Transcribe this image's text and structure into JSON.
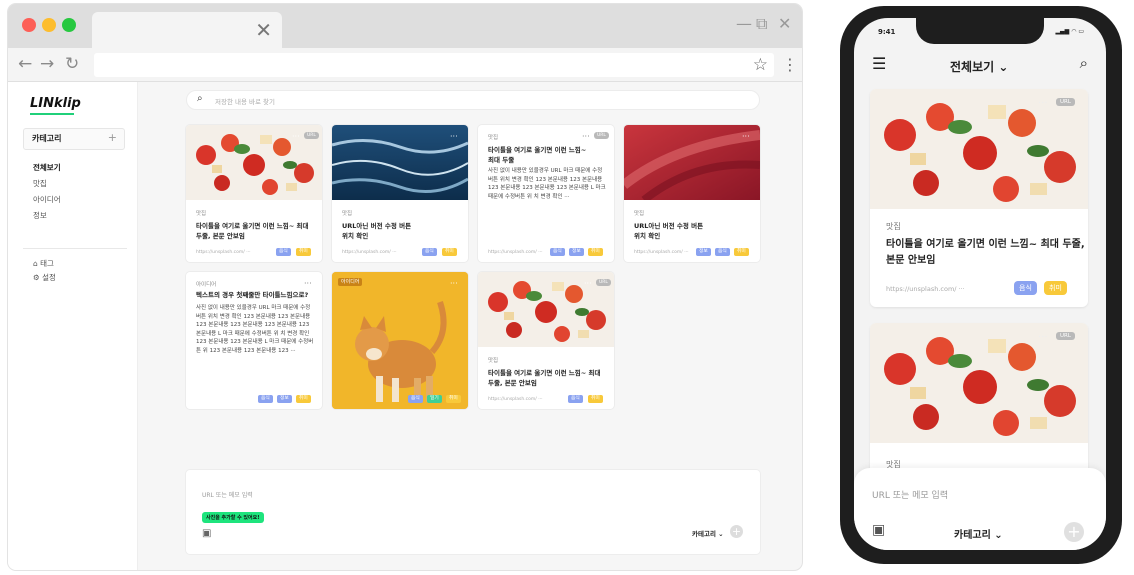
{
  "browser": {
    "tab_close": "✕",
    "nav": {
      "back": "←",
      "forward": "→",
      "reload": "↻"
    },
    "star": "☆",
    "kebab": "⋮",
    "window_controls": {
      "minimize": "—",
      "restore": "⧉",
      "close": "✕"
    }
  },
  "app": {
    "logo": "LINklip",
    "sidebar": {
      "category_header": "카테고리",
      "add": "+",
      "items": [
        "전체보기",
        "맛집",
        "아이디어",
        "정보"
      ],
      "bottom_items": [
        {
          "icon": "⌂",
          "label": "태그"
        },
        {
          "icon": "⚙",
          "label": "설정"
        }
      ]
    },
    "search": {
      "placeholder": "저장한 내용 바로 찾기"
    },
    "cards": [
      {
        "category": "맛집",
        "title": "타이틀을 여기로 올기면 이런 느낌~ 최대 두줄, 본문 안보임",
        "url": "https://unsplash.com/ ···",
        "tags": [
          "음식",
          "취미"
        ],
        "badge": "URL",
        "more": "···"
      },
      {
        "category": "맛집",
        "title": "URL아닌 버전 수정 버튼 위치 확인",
        "url": "https://unsplash.com/ ···",
        "tags": [
          "음식",
          "취미"
        ],
        "more": "···"
      },
      {
        "category": "맛집",
        "title": "타이틀을 여기로 올기면 이런 느낌~ 최대 두줄",
        "body": "사진 없이 내용만 있을경우 URL 마크 때문에 수정버튼 위치 변경 확인 123 본문내용 123 본문내용 123 본문내용 123 본문내용 123 본문내용 L 마크 때문에 수정버튼 위 치 변경 확인 ···",
        "url": "https://unsplash.com/ ···",
        "tags": [
          "음식",
          "정보",
          "취미"
        ],
        "badge": "URL",
        "more": "···"
      },
      {
        "category": "맛집",
        "title": "URL아닌 버전 수정 버튼 위치 확인",
        "url": "https://unsplash.com/ ···",
        "tags": [
          "정보",
          "음식",
          "취미"
        ],
        "more": "···"
      },
      {
        "category": "아이디어",
        "title": "텍스트의 경우 첫째줄만 타이틀느낌으로?",
        "body": "사진 없이 내용만 있을경우 URL 마크 때문에 수정버튼 위치 변경 확인 123 본문내용 123 본문내용 123 본문내용 123 본문내용 123 본문내용 123 본문내용 L 마크 때문에 수정버튼 위 치 변경 확인 123 본문내용 123 본문내용 L 마크 때문에 수정버튼 위 123 본문내용 123 본문내용 123 ···",
        "tags": [
          "음식",
          "정보",
          "취미"
        ],
        "more": "···"
      },
      {
        "label": "아이디어",
        "tags": [
          "음식",
          "일기",
          "취미"
        ],
        "more": "···"
      },
      {
        "category": "맛집",
        "title": "타이틀을 여기로 올기면 이런 느낌~ 최대 두줄, 본문 안보임",
        "url": "https://unsplash.com/ ···",
        "tags": [
          "음식",
          "취미"
        ],
        "badge": "URL",
        "more": "···"
      }
    ],
    "memo": {
      "placeholder": "URL 또는 메모 입력",
      "tip": "사진을 추가할 수 있어요!",
      "category": "카테고리 ⌄",
      "add": "+"
    }
  },
  "mobile": {
    "time": "9:41",
    "status_icons": "▂▄▆ ◠ ▭",
    "title": "전체보기 ⌄",
    "cards": [
      {
        "category": "맛집",
        "title": "타이틀을 여기로 올기면 이런 느낌~ 최대 두줄, 본문 안보임",
        "url": "https://unsplash.com/ ···",
        "tags": [
          "음식",
          "취미"
        ],
        "badge": "URL",
        "more": "···"
      },
      {
        "category": "맛집",
        "badge": "URL",
        "more": "···"
      }
    ],
    "bottom": {
      "placeholder": "URL 또는 메모 입력",
      "category": "카테고리 ⌄",
      "add": "+"
    }
  },
  "colors": {
    "accent": "#1ee47d",
    "tag_blue": "#8aa2f0",
    "tag_yellow": "#f8c93a",
    "tag_green": "#3fcf95"
  }
}
